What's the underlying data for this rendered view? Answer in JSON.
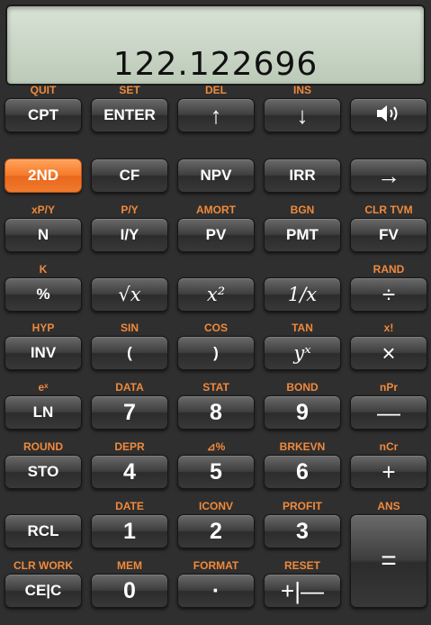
{
  "display": {
    "value": "122.122696"
  },
  "rows": [
    {
      "sec": [
        "QUIT",
        "SET",
        "DEL",
        "INS",
        ""
      ],
      "keys": [
        "CPT",
        "ENTER",
        "↑",
        "↓",
        ""
      ]
    },
    {
      "sec": [
        "",
        "",
        "",
        "",
        ""
      ],
      "keys": [
        "2ND",
        "CF",
        "NPV",
        "IRR",
        "→"
      ]
    },
    {
      "sec": [
        "xP/Y",
        "P/Y",
        "AMORT",
        "BGN",
        "CLR TVM"
      ],
      "keys": [
        "N",
        "I/Y",
        "PV",
        "PMT",
        "FV"
      ]
    },
    {
      "sec": [
        "K",
        "",
        "",
        "",
        "RAND"
      ],
      "keys": [
        "%",
        "√x",
        "x²",
        "1/x",
        "÷"
      ]
    },
    {
      "sec": [
        "HYP",
        "SIN",
        "COS",
        "TAN",
        "x!"
      ],
      "keys": [
        "INV",
        "(",
        ")",
        "yˣ",
        "×"
      ]
    },
    {
      "sec": [
        "eˣ",
        "DATA",
        "STAT",
        "BOND",
        "nPr"
      ],
      "keys": [
        "LN",
        "7",
        "8",
        "9",
        "—"
      ]
    },
    {
      "sec": [
        "ROUND",
        "DEPR",
        "⊿%",
        "BRKEVN",
        "nCr"
      ],
      "keys": [
        "STO",
        "4",
        "5",
        "6",
        "+"
      ]
    },
    {
      "sec": [
        "",
        "DATE",
        "ICONV",
        "PROFIT",
        "ANS"
      ],
      "keys": [
        "RCL",
        "1",
        "2",
        "3",
        "="
      ]
    },
    {
      "sec": [
        "CLR WORK",
        "MEM",
        "FORMAT",
        "RESET",
        ""
      ],
      "keys": [
        "CE|C",
        "0",
        "·",
        "+|—",
        ""
      ]
    }
  ],
  "icons": {
    "speaker": "speaker-icon"
  },
  "colors": {
    "accent": "#f5782a",
    "secondary_label": "#f08a3c",
    "display_bg": "#c8d3c4"
  }
}
